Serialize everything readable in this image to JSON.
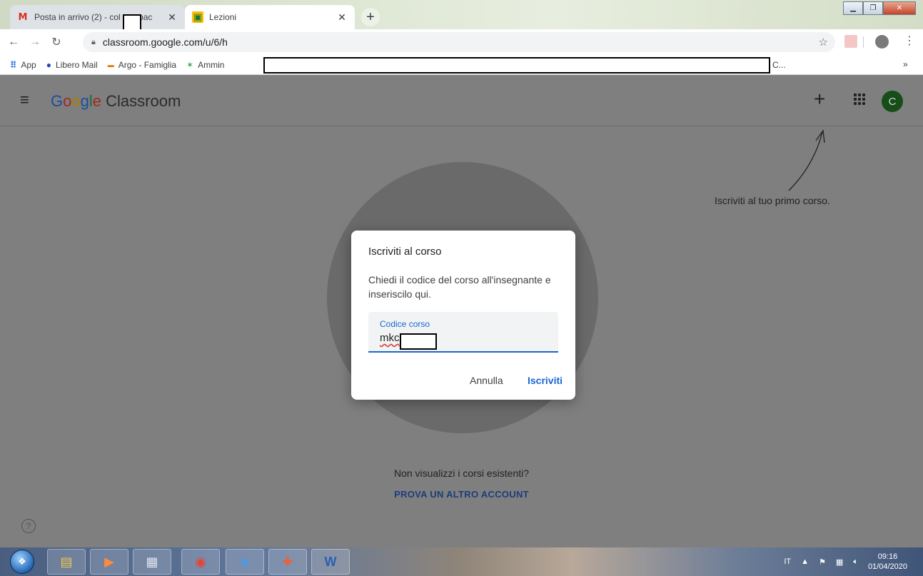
{
  "browser": {
    "tabs": [
      {
        "title": "Posta in arrivo (2) - col",
        "title_tail": ".pac",
        "favicon": "gmail-icon",
        "active": false
      },
      {
        "title": "Lezioni",
        "favicon": "classroom-icon",
        "active": true
      }
    ],
    "new_tab": "+",
    "address": "classroom.google.com/u/6/h",
    "bookmarks": [
      {
        "label": "App",
        "icon": "apps-grid-icon"
      },
      {
        "label": "Libero Mail",
        "icon": "libero-icon"
      },
      {
        "label": "Argo - Famiglia",
        "icon": "argo-icon"
      },
      {
        "label": "Ammin",
        "icon": "admin-icon"
      }
    ],
    "bookmarks_tail": "C...",
    "bookmarks_more": "»"
  },
  "header": {
    "brand_google": [
      "G",
      "o",
      "o",
      "g",
      "l",
      "e"
    ],
    "brand_product": "Classroom",
    "avatar_initial": "C"
  },
  "hint": "Iscriviti al tuo primo corso.",
  "dialog": {
    "title": "Iscriviti al corso",
    "text": "Chiedi il codice del corso all'insegnante e inseriscilo qui.",
    "field_label": "Codice corso",
    "field_value": "mkc",
    "cancel": "Annulla",
    "join": "Iscriviti"
  },
  "empty_state": {
    "message": "Non visualizzi i corsi esistenti?",
    "action": "PROVA UN ALTRO ACCOUNT"
  },
  "taskbar": {
    "language": "IT",
    "time": "09:16",
    "date": "01/04/2020"
  },
  "colors": {
    "accent": "#1967d2",
    "avatar": "#174d19",
    "overlay": "#7f7f7f"
  }
}
